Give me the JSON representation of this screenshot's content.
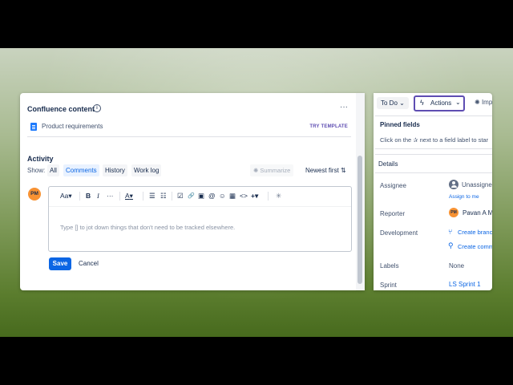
{
  "left_panel": {
    "confluence_title": "Confluence content",
    "info_icon": "info-icon",
    "more_icon": "more-icon",
    "doc_item": "Product requirements",
    "try_template": "TRY TEMPLATE",
    "activity_heading": "Activity",
    "show_label": "Show:",
    "filters": [
      "All",
      "Comments",
      "History",
      "Work log"
    ],
    "summarize_label": "Summarize",
    "newest_first_label": "Newest first",
    "avatar_initials": "PM",
    "editor": {
      "toolbar": {
        "text_style": "Aa",
        "bold": "B",
        "italic": "I",
        "more": "···",
        "text_color": "A",
        "bullet_list": "☰",
        "numbered_list": "☷",
        "checkbox": "☑",
        "link": "🔗",
        "image": "▣",
        "mention": "@",
        "emoji": "☺",
        "table": "▦",
        "code": "<>",
        "insert": "+",
        "ai": "✳"
      },
      "placeholder": "Type [] to jot down things that don't need to be tracked elsewhere."
    },
    "save_label": "Save",
    "cancel_label": "Cancel"
  },
  "right_panel": {
    "status_label": "To Do",
    "actions_label": "Actions",
    "imp_label": "Imp",
    "pinned_heading": "Pinned fields",
    "pinned_text": "Click on the ✰ next to a field label to star",
    "details_heading": "Details",
    "fields": {
      "assignee_label": "Assignee",
      "assignee_value": "Unassigne",
      "assign_to_me": "Assign to me",
      "reporter_label": "Reporter",
      "reporter_value": "Pavan A M",
      "reporter_initials": "PM",
      "development_label": "Development",
      "create_branch": "Create branc",
      "create_commit": "Create comm",
      "labels_label": "Labels",
      "labels_value": "None",
      "sprint_label": "Sprint",
      "sprint_value": "LS Sprint 1"
    }
  },
  "colors": {
    "accent_blue": "#0c66e4",
    "purple_border": "#5e4db2",
    "avatar_orange": "#f79233"
  }
}
